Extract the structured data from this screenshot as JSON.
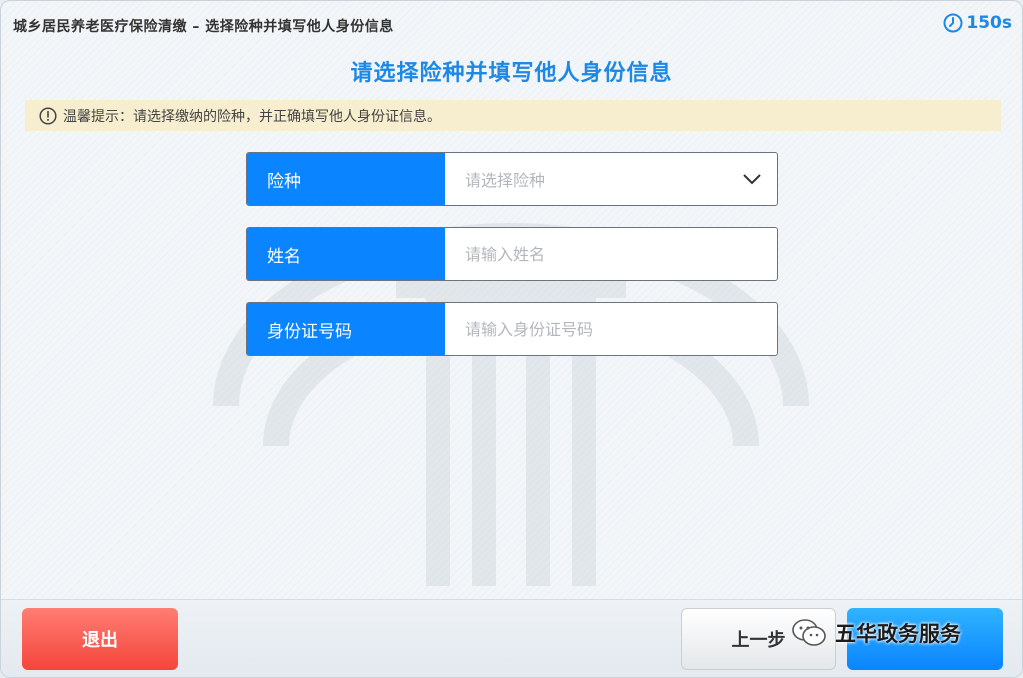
{
  "header": {
    "breadcrumb": "城乡居民养老医疗保险清缴  –  选择险种并填写他人身份信息",
    "timer": "150s"
  },
  "page_title": "请选择险种并填写他人身份信息",
  "tip": {
    "text": "温馨提示：请选择缴纳的险种，并正确填写他人身份证信息。"
  },
  "form": {
    "insurance": {
      "label": "险种",
      "placeholder": "请选择险种"
    },
    "name": {
      "label": "姓名",
      "placeholder": "请输入姓名"
    },
    "id_number": {
      "label": "身份证号码",
      "placeholder": "请输入身份证号码"
    }
  },
  "footer": {
    "exit_label": "退出",
    "prev_label": "上一步",
    "next_label": ""
  },
  "watermark": {
    "brand_text": "五华政务服务"
  },
  "colors": {
    "accent": "#0a84ff",
    "title_blue": "#1e88e5",
    "exit_red": "#f5453b",
    "tip_bg": "#f7eecf"
  }
}
